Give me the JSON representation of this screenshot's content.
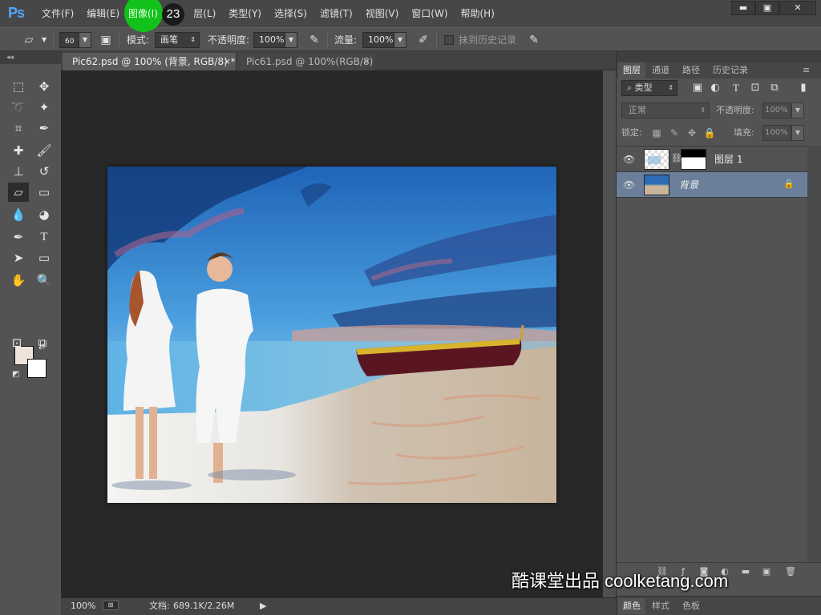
{
  "app": {
    "logo": "Ps"
  },
  "menu": [
    "文件(F)",
    "编辑(E)",
    "图像(I)",
    "图层(L)",
    "类型(Y)",
    "选择(S)",
    "滤镜(T)",
    "视图(V)",
    "窗口(W)",
    "帮助(H)"
  ],
  "menu_visible": {
    "file": "文件(F)",
    "edit": "编辑(E)",
    "image": "图像(I)",
    "layer_tail": "层(L)",
    "type": "类型(Y)",
    "select": "选择(S)",
    "filter": "滤镜(T)",
    "view": "视图(V)",
    "window": "窗口(W)",
    "help": "帮助(H)"
  },
  "tutorial": {
    "step_number": "23",
    "marker_color": "#12c21a"
  },
  "window_controls": {
    "minimize": "▬",
    "maximize": "▣",
    "close": "✕"
  },
  "options": {
    "brush_size": "60",
    "mode_label": "模式:",
    "mode_value": "画笔",
    "opacity_label": "不透明度:",
    "opacity_value": "100%",
    "flow_label": "流量:",
    "flow_value": "100%",
    "erase_history_label": "抹到历史记录"
  },
  "tabs": [
    {
      "label": "Pic62.psd @ 100% (背景, RGB/8) *",
      "close": "×",
      "active": true
    },
    {
      "label": "Pic61.psd @ 100%(RGB/8)",
      "close": "×",
      "active": false
    }
  ],
  "status": {
    "zoom": "100%",
    "doc_label": "文档:",
    "doc_value": "689.1K/2.26M",
    "arrow": "▶"
  },
  "panel": {
    "tabs": [
      "图层",
      "通道",
      "路径",
      "历史记录"
    ],
    "filter_kind": "类型",
    "blend_mode": "正常",
    "opacity_label": "不透明度:",
    "opacity_value": "100%",
    "lock_label": "锁定:",
    "fill_label": "填充:",
    "fill_value": "100%",
    "layers": [
      {
        "name": "图层 1",
        "selected": false
      },
      {
        "name": "背景",
        "selected": true
      }
    ],
    "bottom_tabs": [
      "颜色",
      "样式",
      "色板"
    ]
  },
  "colors": {
    "foreground": "#efe3dc",
    "background": "#ffffff",
    "selected_layer": "#6b7f9b",
    "ps_blue": "#4fa8ff"
  },
  "watermark": "酷课堂出品 coolketang.com"
}
